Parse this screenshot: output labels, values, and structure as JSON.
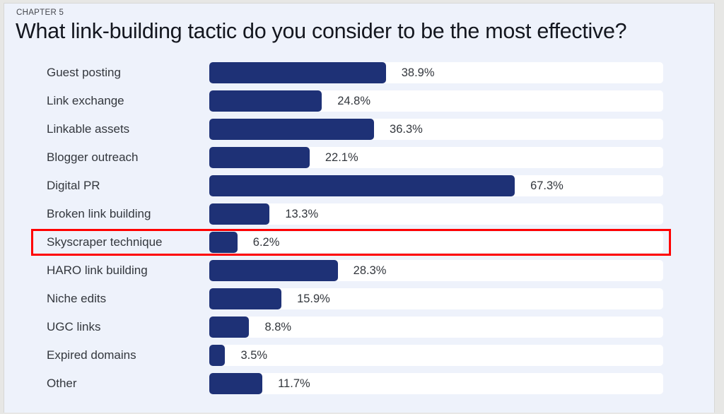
{
  "header": {
    "chapter": "CHAPTER 5",
    "title": "What link-building tactic do you consider to be the most effective?"
  },
  "colors": {
    "bar": "#1e3176",
    "track": "#ffffff",
    "background": "#eef2fb",
    "highlight": "#ff0000",
    "label_text": "#33373d",
    "title_text": "#14171f"
  },
  "highlight": {
    "row_label": "Skyscraper technique",
    "row_index": 6
  },
  "chart_data": {
    "type": "bar",
    "orientation": "horizontal",
    "title": "What link-building tactic do you consider to be the most effective?",
    "subtitle": "CHAPTER 5",
    "xlabel": "",
    "ylabel": "",
    "xlim": [
      0,
      100
    ],
    "grid": false,
    "legend": "none",
    "value_suffix": "%",
    "categories": [
      "Guest posting",
      "Link exchange",
      "Linkable assets",
      "Blogger outreach",
      "Digital PR",
      "Broken link building",
      "Skyscraper technique",
      "HARO link building",
      "Niche edits",
      "UGC links",
      "Expired domains",
      "Other"
    ],
    "values": [
      38.9,
      24.8,
      36.3,
      22.1,
      67.3,
      13.3,
      6.2,
      28.3,
      15.9,
      8.8,
      3.5,
      11.7
    ],
    "value_labels": [
      "38.9%",
      "24.8%",
      "36.3%",
      "22.1%",
      "67.3%",
      "13.3%",
      "6.2%",
      "28.3%",
      "15.9%",
      "8.8%",
      "3.5%",
      "11.7%"
    ]
  }
}
